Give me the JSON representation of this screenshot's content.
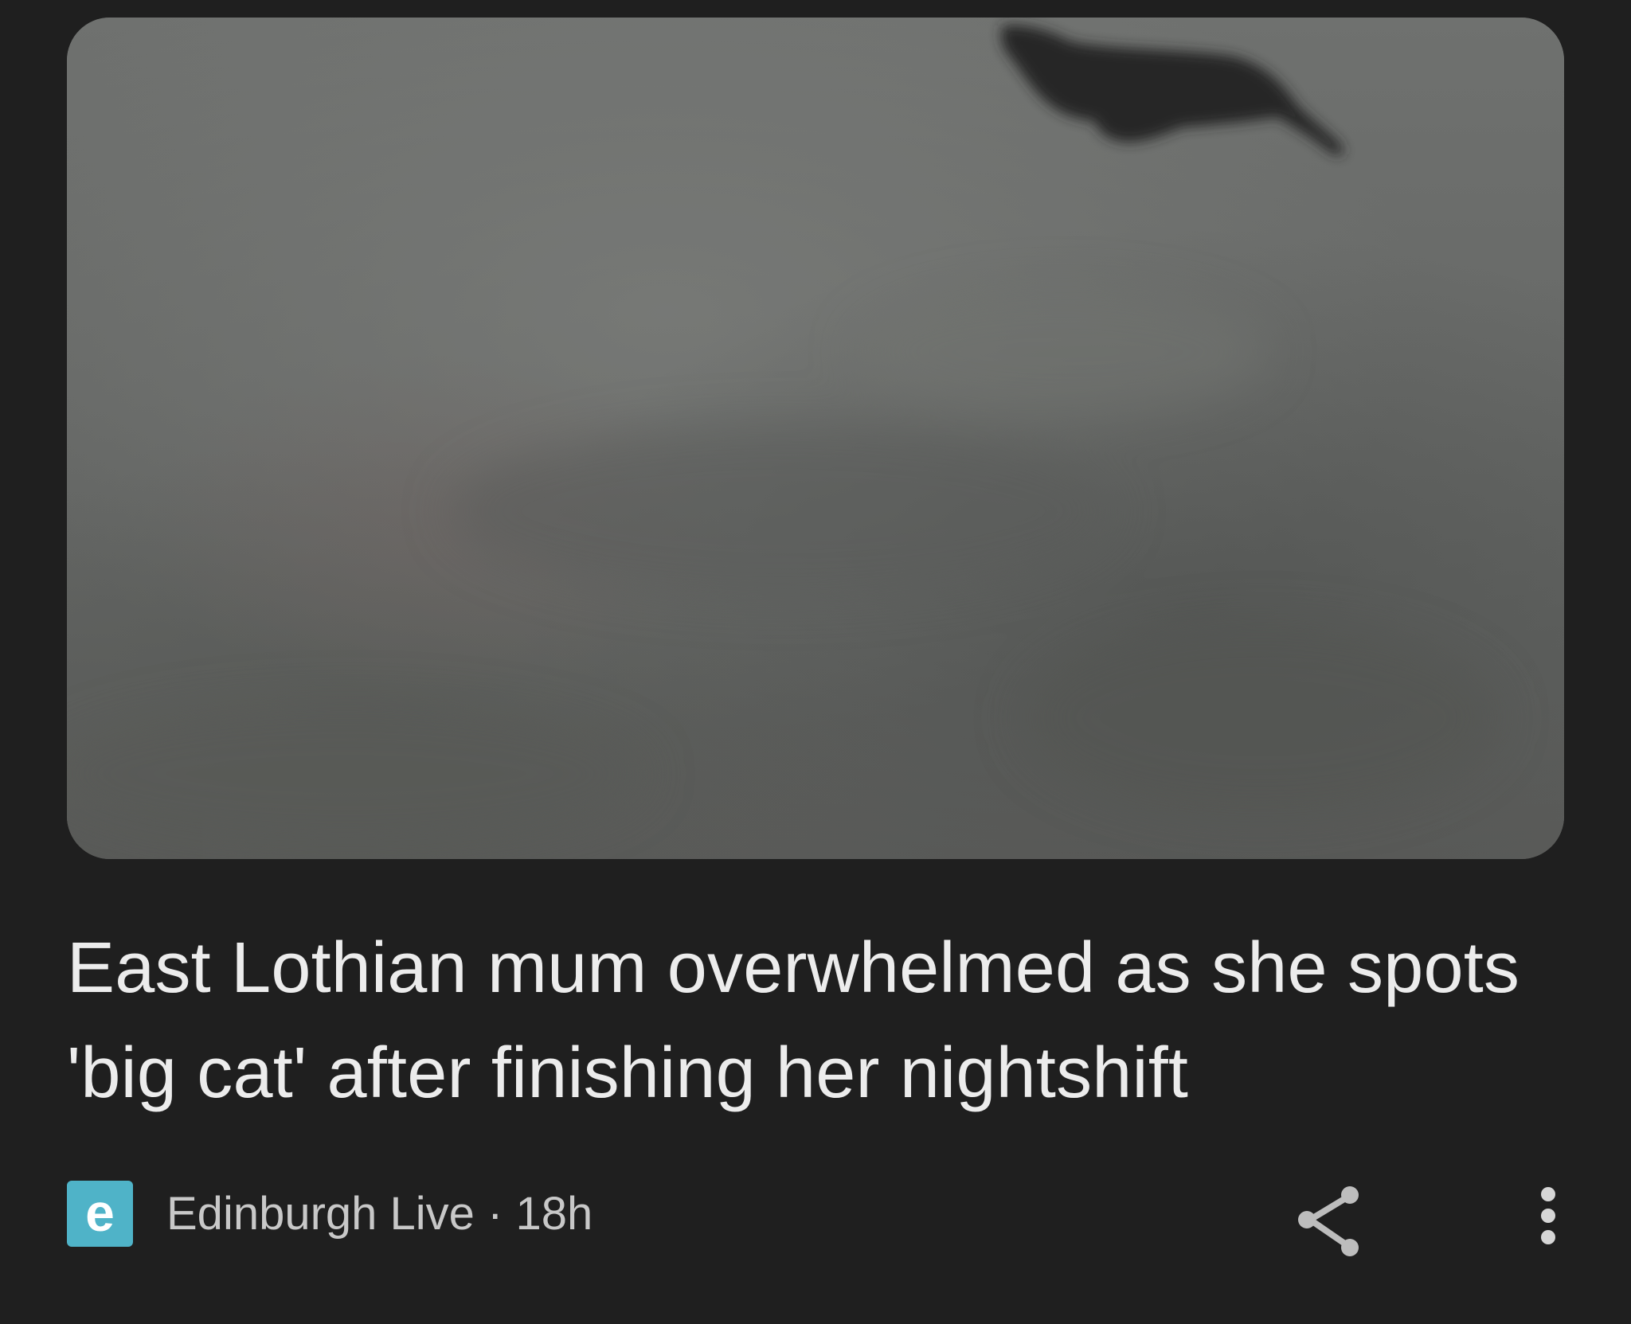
{
  "article": {
    "headline": "East Lothian mum overwhelmed as she spots 'big cat' after finishing her nightshift",
    "image_icon": "foggy-field-big-cat-photo",
    "source": {
      "logo_letter": "e",
      "logo_color": "#4fb3c8",
      "name": "Edinburgh Live",
      "separator": "·",
      "age": "18h"
    },
    "actions": {
      "share_icon": "share-icon",
      "more_icon": "more-vertical-icon"
    }
  },
  "colors": {
    "background": "#1f1f1f",
    "headline_text": "#ececec",
    "meta_text": "#c8c8c8",
    "icon": "#bdbdbd"
  }
}
